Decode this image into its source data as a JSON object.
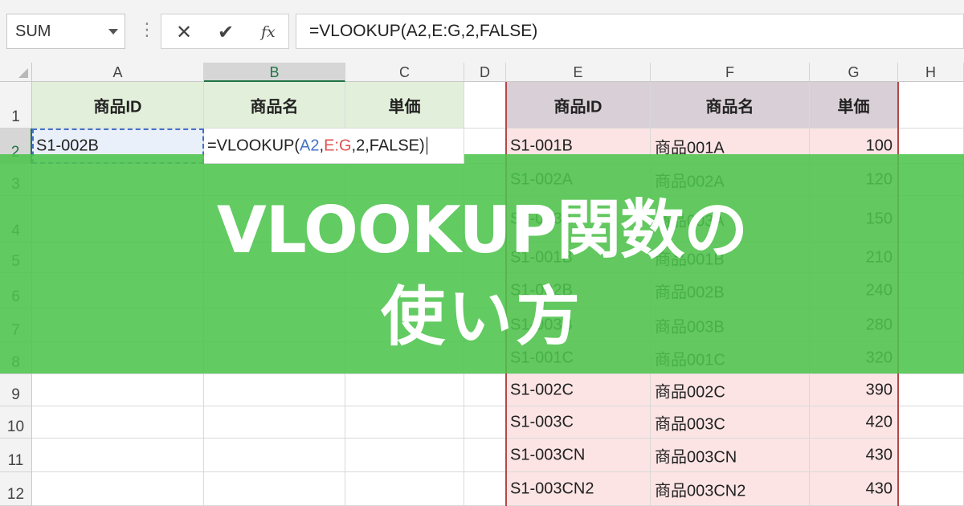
{
  "formula_bar": {
    "name_box": "SUM",
    "name_box_icon": "chevron-down-icon",
    "cancel_glyph": "✕",
    "enter_glyph": "✔",
    "fx_label": "fx",
    "formula": "=VLOOKUP(A2,E:G,2,FALSE)"
  },
  "columns": [
    "A",
    "B",
    "C",
    "D",
    "E",
    "F",
    "G",
    "H"
  ],
  "rows": [
    "1",
    "2",
    "3",
    "4",
    "5",
    "6",
    "7",
    "8",
    "9",
    "10",
    "11",
    "12"
  ],
  "lookup": {
    "headers": [
      "商品ID",
      "商品名",
      "単価"
    ],
    "a2_value": "S1-002B",
    "b2_formula": {
      "prefix": "=VLOOKUP(",
      "ref1": "A2",
      "sep1": ",",
      "ref2": "E:G",
      "suffix": ",2,FALSE)"
    }
  },
  "table": {
    "headers": [
      "商品ID",
      "商品名",
      "単価"
    ],
    "rows": [
      [
        "S1-001B",
        "商品001A",
        "100"
      ],
      [
        "S1-002A",
        "商品002A",
        "120"
      ],
      [
        "S1-003A",
        "商品003A",
        "150"
      ],
      [
        "S1-001B",
        "商品001B",
        "210"
      ],
      [
        "S1-002B",
        "商品002B",
        "240"
      ],
      [
        "S1-003B",
        "商品003B",
        "280"
      ],
      [
        "S1-001C",
        "商品001C",
        "320"
      ],
      [
        "S1-002C",
        "商品002C",
        "390"
      ],
      [
        "S1-003C",
        "商品003C",
        "420"
      ],
      [
        "S1-003CN",
        "商品003CN",
        "430"
      ],
      [
        "S1-003CN2",
        "商品003CN2",
        "430"
      ]
    ]
  },
  "banner": {
    "line1": "VLOOKUP関数の",
    "line2": "使い方"
  },
  "colors": {
    "banner": "#4cc44c",
    "header_green": "#e2efda",
    "header_mauve": "#d9cfd6",
    "table_pink": "#fce4e4",
    "ref_blue": "#4472c4",
    "ref_red": "#e05050",
    "excel_green": "#217346"
  }
}
